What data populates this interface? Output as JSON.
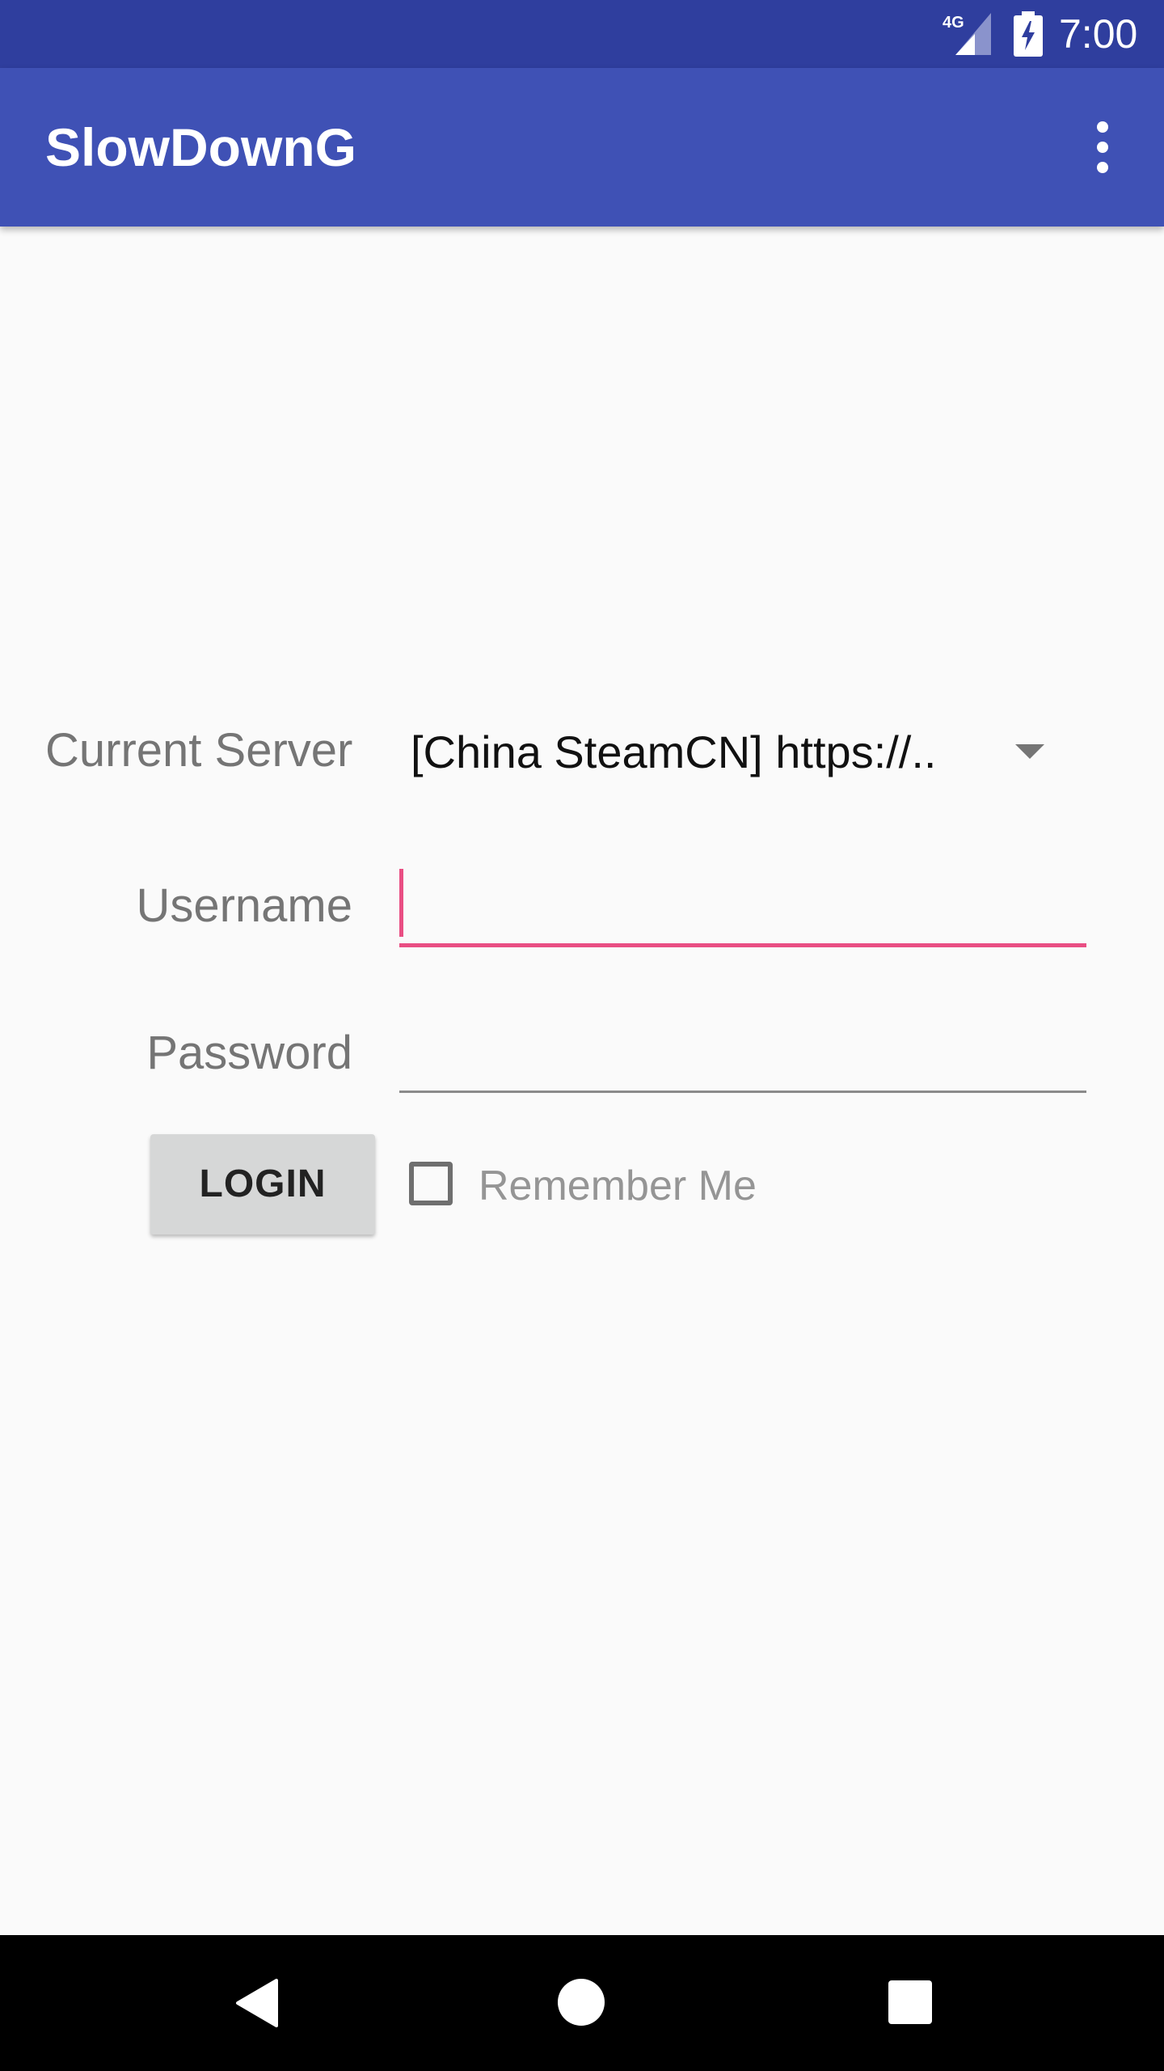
{
  "status_bar": {
    "network_label": "4G",
    "time": "7:00",
    "icons": [
      "signal-icon",
      "battery-charging-icon"
    ]
  },
  "app_bar": {
    "title": "SlowDownG",
    "menu_icon": "more-vert-icon"
  },
  "form": {
    "server_label": "Current Server",
    "server_value": "[China SteamCN] https://..",
    "username_label": "Username",
    "username_value": "",
    "password_label": "Password",
    "password_value": "",
    "login_button": "LOGIN",
    "remember_me_label": "Remember Me",
    "remember_me_checked": false
  },
  "nav_bar": {
    "icons": [
      "back-icon",
      "home-icon",
      "recents-icon"
    ]
  },
  "colors": {
    "status_bar": "#2F3E9E",
    "app_bar": "#3F51B5",
    "accent": "#E94E83",
    "background": "#FAFAFA"
  }
}
